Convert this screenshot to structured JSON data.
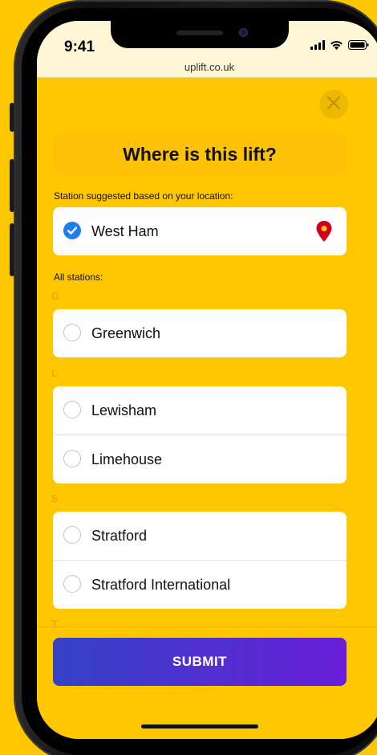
{
  "status_bar": {
    "time": "9:41",
    "url": "uplift.co.uk"
  },
  "page": {
    "title": "Where is this lift?",
    "suggested_label": "Station suggested based on your location:",
    "all_label": "All stations:"
  },
  "suggested": {
    "name": "West Ham",
    "selected": true
  },
  "groups": [
    {
      "letter": "G",
      "stations": [
        {
          "name": "Greenwich"
        }
      ]
    },
    {
      "letter": "L",
      "stations": [
        {
          "name": "Lewisham"
        },
        {
          "name": "Limehouse"
        }
      ]
    },
    {
      "letter": "S",
      "stations": [
        {
          "name": "Stratford"
        },
        {
          "name": "Stratford International"
        }
      ]
    },
    {
      "letter": "T",
      "stations": []
    }
  ],
  "submit_label": "SUBMIT",
  "colors": {
    "background": "#FFC700",
    "accent_blue": "#1E7EF0",
    "pin_red": "#D0021B",
    "button_start": "#3442C6",
    "button_end": "#6A1FD8"
  },
  "icons": {
    "close": "close-icon",
    "check": "check-icon",
    "pin": "location-pin-icon",
    "signal": "signal-icon",
    "wifi": "wifi-icon",
    "battery": "battery-icon"
  }
}
